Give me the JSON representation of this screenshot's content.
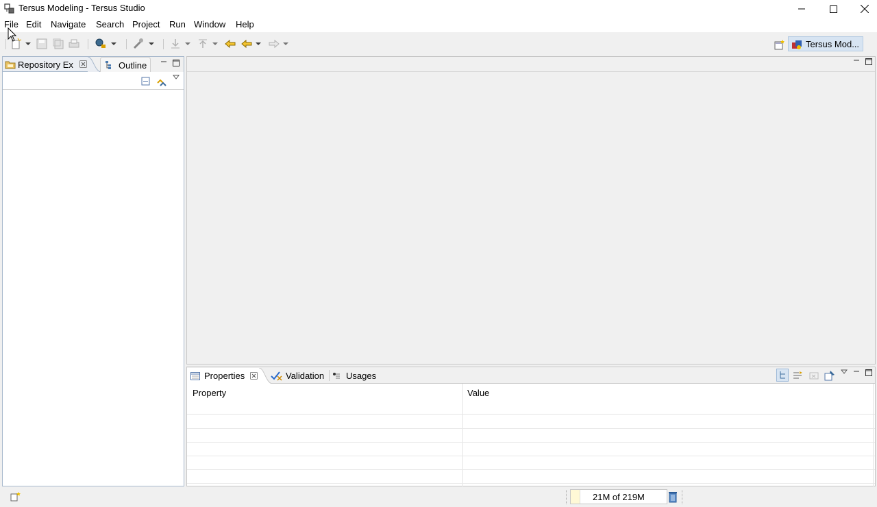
{
  "window": {
    "title": "Tersus Modeling - Tersus Studio"
  },
  "menu": [
    "File",
    "Edit",
    "Navigate",
    "Search",
    "Project",
    "Run",
    "Window",
    "Help"
  ],
  "toolbar": {
    "icons": [
      "new-icon",
      "save-icon",
      "save-all-icon",
      "print-icon",
      "search-icon",
      "run-icon",
      "import-icon",
      "export-icon",
      "back-history-icon",
      "back-icon",
      "forward-icon"
    ]
  },
  "perspective": {
    "label": "Tersus Mod..."
  },
  "left_view": {
    "tabs": [
      "Repository Ex",
      "Outline"
    ]
  },
  "bottom_view": {
    "tabs": [
      "Properties",
      "Validation",
      "Usages"
    ],
    "columns": [
      "Property",
      "Value"
    ]
  },
  "status": {
    "memory": "21M of 219M"
  },
  "colors": {
    "active_tab_bg": "#ebeef3",
    "view_border": "#a7b8cc",
    "perspective_bg": "#d7e4f2"
  }
}
